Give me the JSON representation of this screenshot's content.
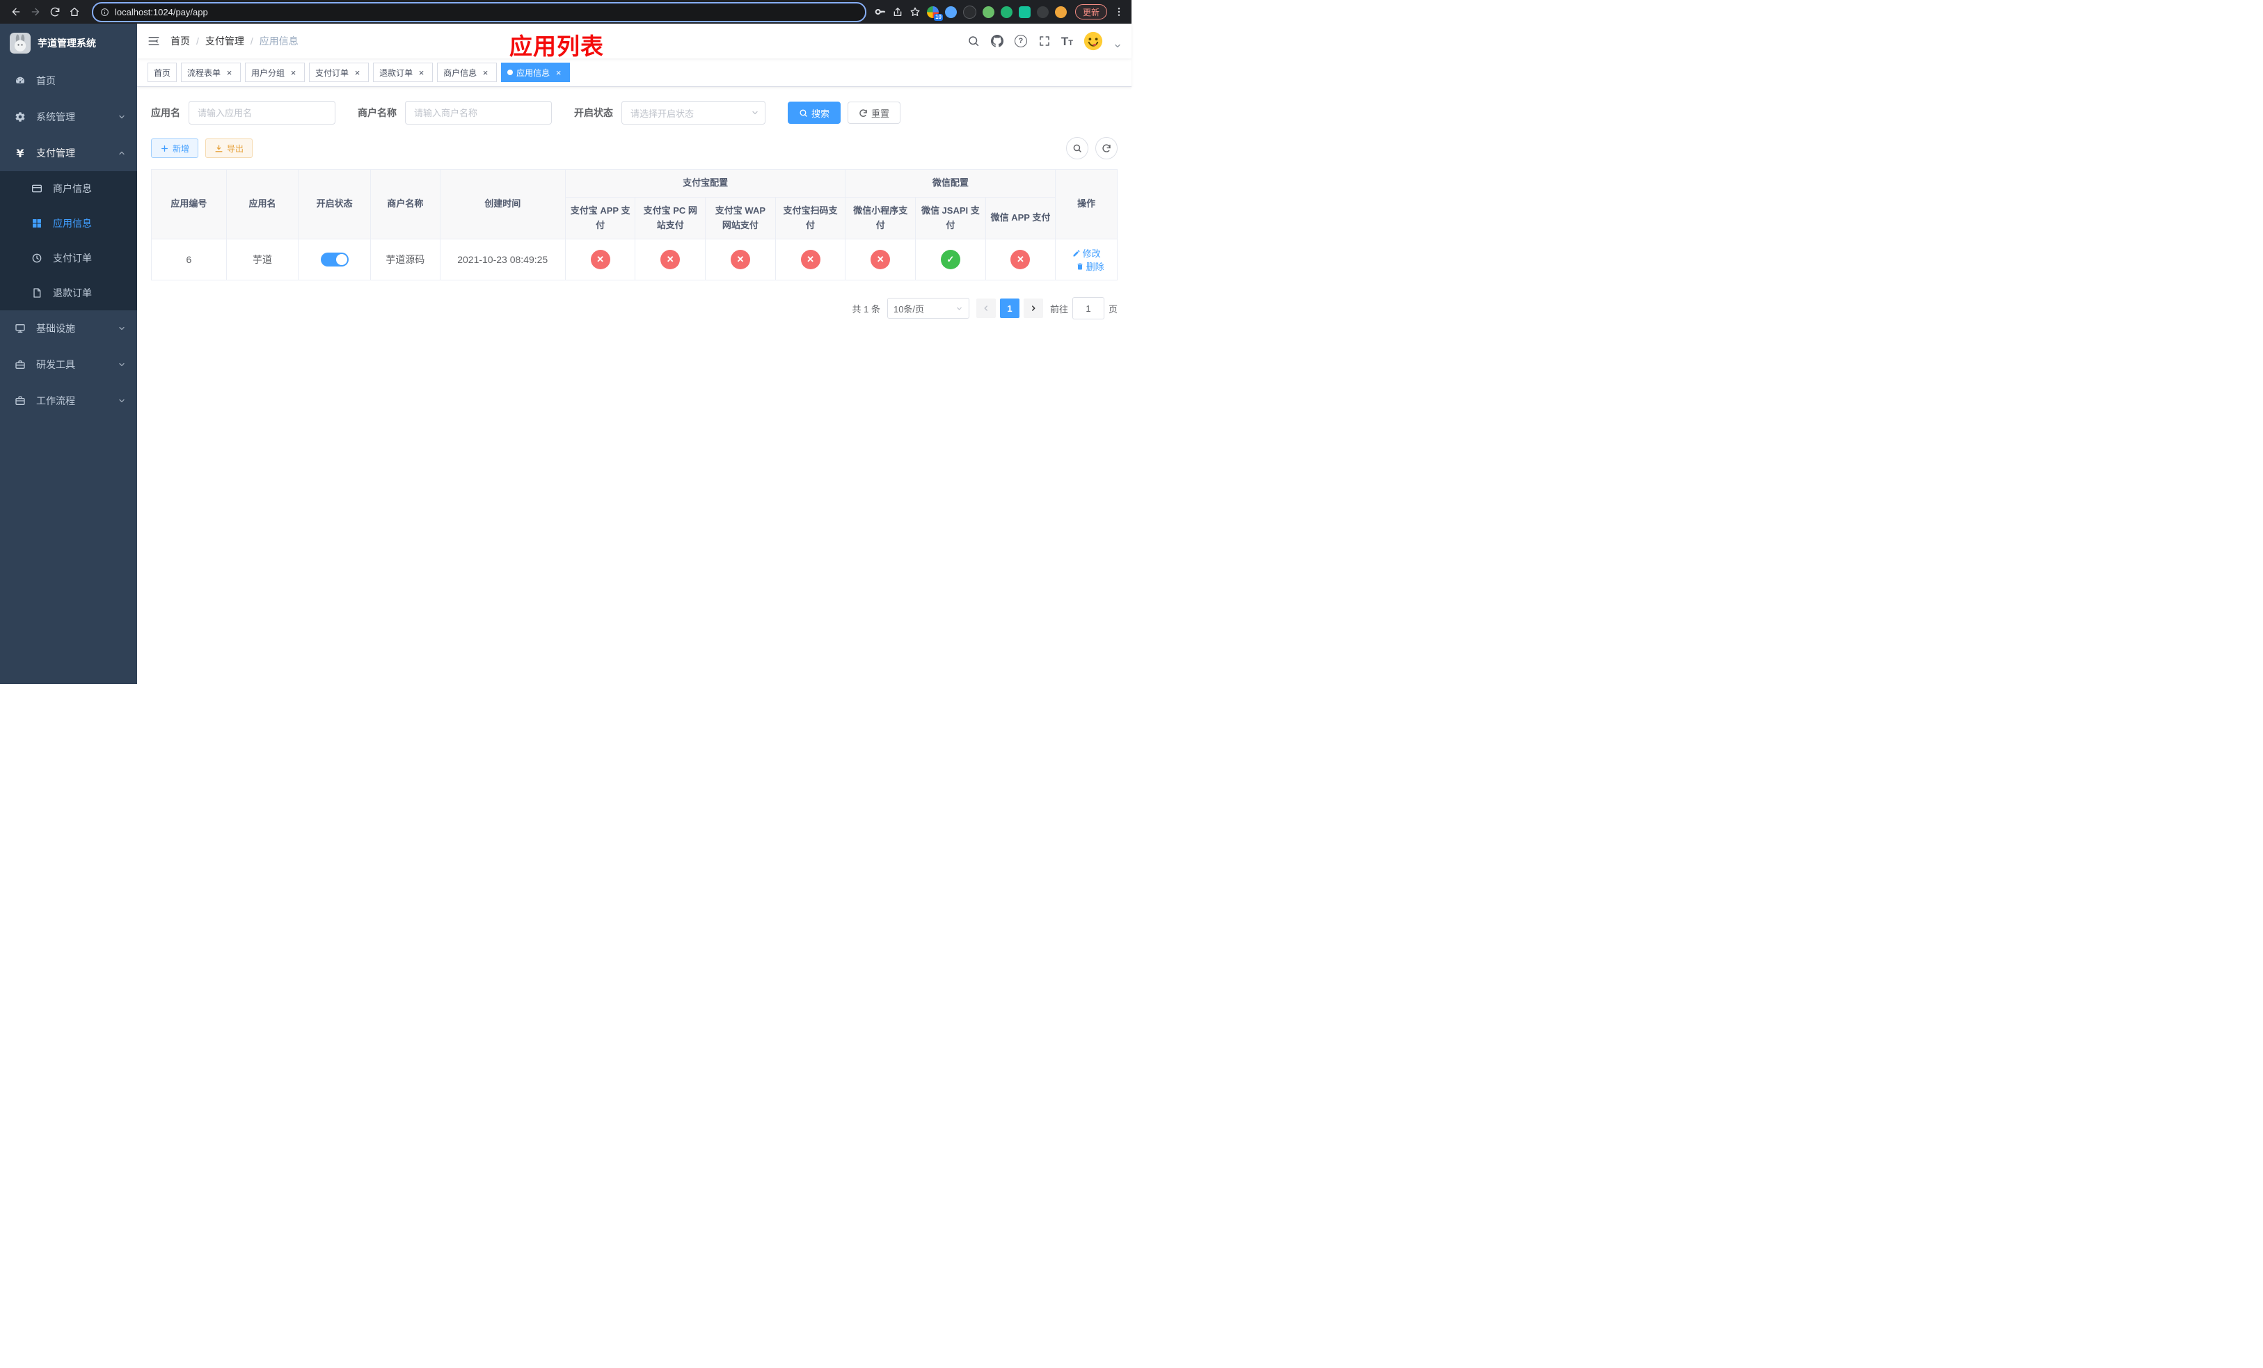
{
  "browser": {
    "url": "localhost:1024/pay/app",
    "update_button": "更新",
    "extension_badge": "10"
  },
  "app": {
    "logo_title": "芋道管理系统",
    "annotation_title": "应用列表"
  },
  "sidebar": {
    "items": [
      {
        "label": "首页"
      },
      {
        "label": "系统管理",
        "expanded": false
      },
      {
        "label": "支付管理",
        "expanded": true,
        "children": [
          {
            "label": "商户信息",
            "active": false
          },
          {
            "label": "应用信息",
            "active": true
          },
          {
            "label": "支付订单",
            "active": false
          },
          {
            "label": "退款订单",
            "active": false
          }
        ]
      },
      {
        "label": "基础设施",
        "expanded": false
      },
      {
        "label": "研发工具",
        "expanded": false
      },
      {
        "label": "工作流程",
        "expanded": false
      }
    ]
  },
  "breadcrumb": [
    "首页",
    "支付管理",
    "应用信息"
  ],
  "tabs": [
    {
      "label": "首页",
      "closable": false,
      "active": false
    },
    {
      "label": "流程表单",
      "closable": true,
      "active": false
    },
    {
      "label": "用户分组",
      "closable": true,
      "active": false
    },
    {
      "label": "支付订单",
      "closable": true,
      "active": false
    },
    {
      "label": "退款订单",
      "closable": true,
      "active": false
    },
    {
      "label": "商户信息",
      "closable": true,
      "active": false
    },
    {
      "label": "应用信息",
      "closable": true,
      "active": true
    }
  ],
  "filters": {
    "app_name_label": "应用名",
    "app_name_placeholder": "请输入应用名",
    "merchant_label": "商户名称",
    "merchant_placeholder": "请输入商户名称",
    "status_label": "开启状态",
    "status_placeholder": "请选择开启状态",
    "search_button": "搜索",
    "reset_button": "重置"
  },
  "toolbar": {
    "add_button": "新增",
    "export_button": "导出"
  },
  "table": {
    "headers": [
      "应用编号",
      "应用名",
      "开启状态",
      "商户名称",
      "创建时间",
      "操作"
    ],
    "group_headers": [
      "支付宝配置",
      "微信配置"
    ],
    "sub_headers": [
      "支付宝 APP 支付",
      "支付宝 PC 网站支付",
      "支付宝 WAP 网站支付",
      "支付宝扫码支付",
      "微信小程序支付",
      "微信 JSAPI 支付",
      "微信 APP 支付"
    ],
    "rows": [
      {
        "app_id": "6",
        "app_name": "芋道",
        "enabled": true,
        "merchant_name": "芋道源码",
        "create_time": "2021-10-23 08:49:25",
        "alipay_app": false,
        "alipay_pc": false,
        "alipay_wap": false,
        "alipay_qr": false,
        "wechat_mini": false,
        "wechat_jsapi": true,
        "wechat_app": false,
        "edit_action": "修改",
        "delete_action": "删除"
      }
    ]
  },
  "pagination": {
    "total_text": "共 1 条",
    "page_size": "10条/页",
    "current_page": "1",
    "goto_label": "前往",
    "goto_value": "1",
    "page_unit": "页"
  },
  "colors": {
    "accent": "#409EFF",
    "danger": "#f56c6c",
    "success": "#3fbf4e",
    "sidebar_bg": "#304156",
    "submenu_bg": "#1f2d3d",
    "annotation_red": "#f40b0b"
  }
}
